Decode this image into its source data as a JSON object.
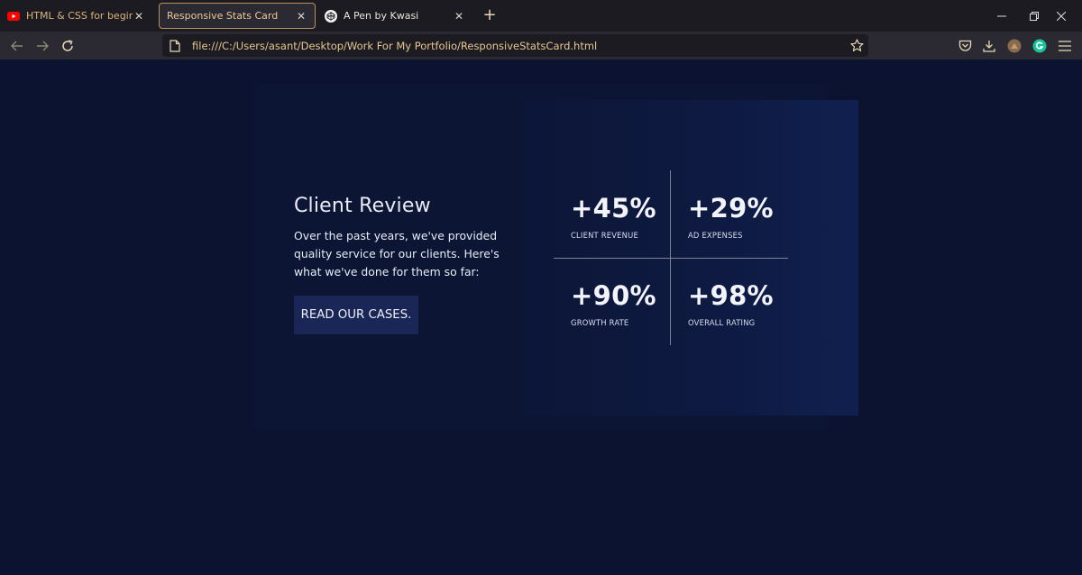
{
  "browser": {
    "tabs": [
      {
        "title": "HTML & CSS for beginners - YouTube",
        "icon": "youtube-icon"
      },
      {
        "title": "Responsive Stats Card",
        "icon": "none"
      },
      {
        "title": "A Pen by Kwasi",
        "icon": "codepen-icon"
      }
    ],
    "url": "file:///C:/Users/asant/Desktop/Work For My Portfolio/ResponsiveStatsCard.html",
    "colors": {
      "tab_bar": "#1c1b22",
      "nav_bar": "#2b2a33",
      "accent": "#b8925a"
    }
  },
  "page": {
    "colors": {
      "background": "#0b1330",
      "card": "#0c1534",
      "button": "#1a2656"
    },
    "review": {
      "title": "Client Review",
      "text": "Over the past years, we've provided quality service for our clients. Here's what we've done for them so far:",
      "button_label": "READ OUR CASES."
    },
    "stats": [
      {
        "value": "+45%",
        "label": "CLIENT REVENUE"
      },
      {
        "value": "+29%",
        "label": "AD EXPENSES"
      },
      {
        "value": "+90%",
        "label": "GROWTH RATE"
      },
      {
        "value": "+98%",
        "label": "OVERALL RATING"
      }
    ]
  }
}
